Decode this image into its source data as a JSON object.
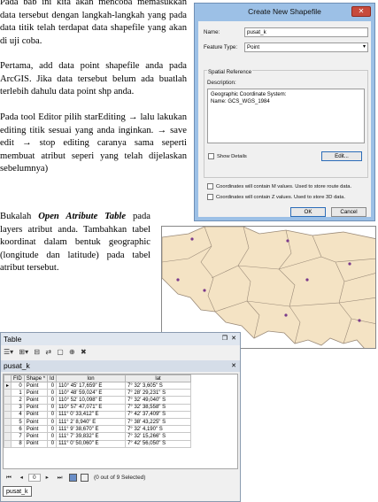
{
  "document": {
    "paragraphs": [
      "Pada bab ini kita akan mencoba memasukkan data tersebut dengan langkah-langkah yang pada data titik telah terdapat data shapefile yang akan di uji coba.",
      "Pertama, add data point shapefile anda pada ArcGIS. Jika data tersebut belum ada buatlah terlebih dahulu data point shp anda.",
      "Pada tool Editor pilih starEditing → lalu lakukan editing titik sesuai yang anda inginkan. → save edit → stop editing caranya sama seperti membuat atribut seperi yang telah dijelaskan sebelumnya)"
    ],
    "para4": {
      "before": "Bukalah ",
      "emph": "Open Atribute Table",
      "after": " pada layers atribut anda. Tambahkan tabel koordinat dalam bentuk geographic (longitude dan latitude) pada tabel atribut tersebut."
    }
  },
  "dialog": {
    "title": "Create New Shapefile",
    "close_label": "✕",
    "name_label": "Name:",
    "name_value": "pusat_k",
    "feature_type_label": "Feature Type:",
    "feature_type_value": "Point",
    "spatial_reference_label": "Spatial Reference",
    "description_label": "Description:",
    "description_lines": [
      "Geographic Coordinate System:",
      "Name: GCS_WGS_1984"
    ],
    "show_details_label": "Show Details",
    "edit_button": "Edit...",
    "m_values_label": "Coordinates will contain M values. Used to store route data.",
    "z_values_label": "Coordinates will contain Z values. Used to store 3D data.",
    "ok_button": "OK",
    "cancel_button": "Cancel"
  },
  "map": {
    "land_color": "#f4e3c4",
    "border_color": "#9a8a78",
    "point_color": "#7a3a8a",
    "highlight_point_color": "#39c6d6"
  },
  "table_window": {
    "title": "Table",
    "toolbar_icons": [
      "table-options-icon",
      "related-tables-icon",
      "select-by-attributes-icon",
      "switch-selection-icon",
      "clear-selection-icon",
      "zoom-to-selected-icon",
      "delete-selected-icon"
    ],
    "tab_label": "pusat_k",
    "columns": [
      "FID",
      "Shape *",
      "Id",
      "lon",
      "lat"
    ],
    "rows": [
      [
        "0",
        "Point",
        "0",
        "110° 45' 17,659\" E",
        "7° 32' 3,605\" S"
      ],
      [
        "1",
        "Point",
        "0",
        "110° 48' 59,024\" E",
        "7° 28' 29,231\" S"
      ],
      [
        "2",
        "Point",
        "0",
        "110° 52' 10,098\" E",
        "7° 32' 49,040\" S"
      ],
      [
        "3",
        "Point",
        "0",
        "110° 57' 47,071\" E",
        "7° 32' 38,558\" S"
      ],
      [
        "4",
        "Point",
        "0",
        "111° 0' 33,412\" E",
        "7° 42' 37,409\" S"
      ],
      [
        "5",
        "Point",
        "0",
        "111° 2' 8,940\" E",
        "7° 38' 43,225\" S"
      ],
      [
        "6",
        "Point",
        "0",
        "111° 9' 38,670\" E",
        "7° 32' 4,190\" S"
      ],
      [
        "7",
        "Point",
        "0",
        "111° 7' 39,832\" E",
        "7° 32' 15,266\" S"
      ],
      [
        "8",
        "Point",
        "0",
        "111° 0' 50,060\" E",
        "7° 42' 56,050\" S"
      ]
    ],
    "nav_first": "⏮",
    "nav_prev": "◂",
    "record_number": "0",
    "nav_next": "▸",
    "nav_last": "⏭",
    "selection_status": "(0 out of 9 Selected)",
    "footer_tab": "pusat_k"
  }
}
